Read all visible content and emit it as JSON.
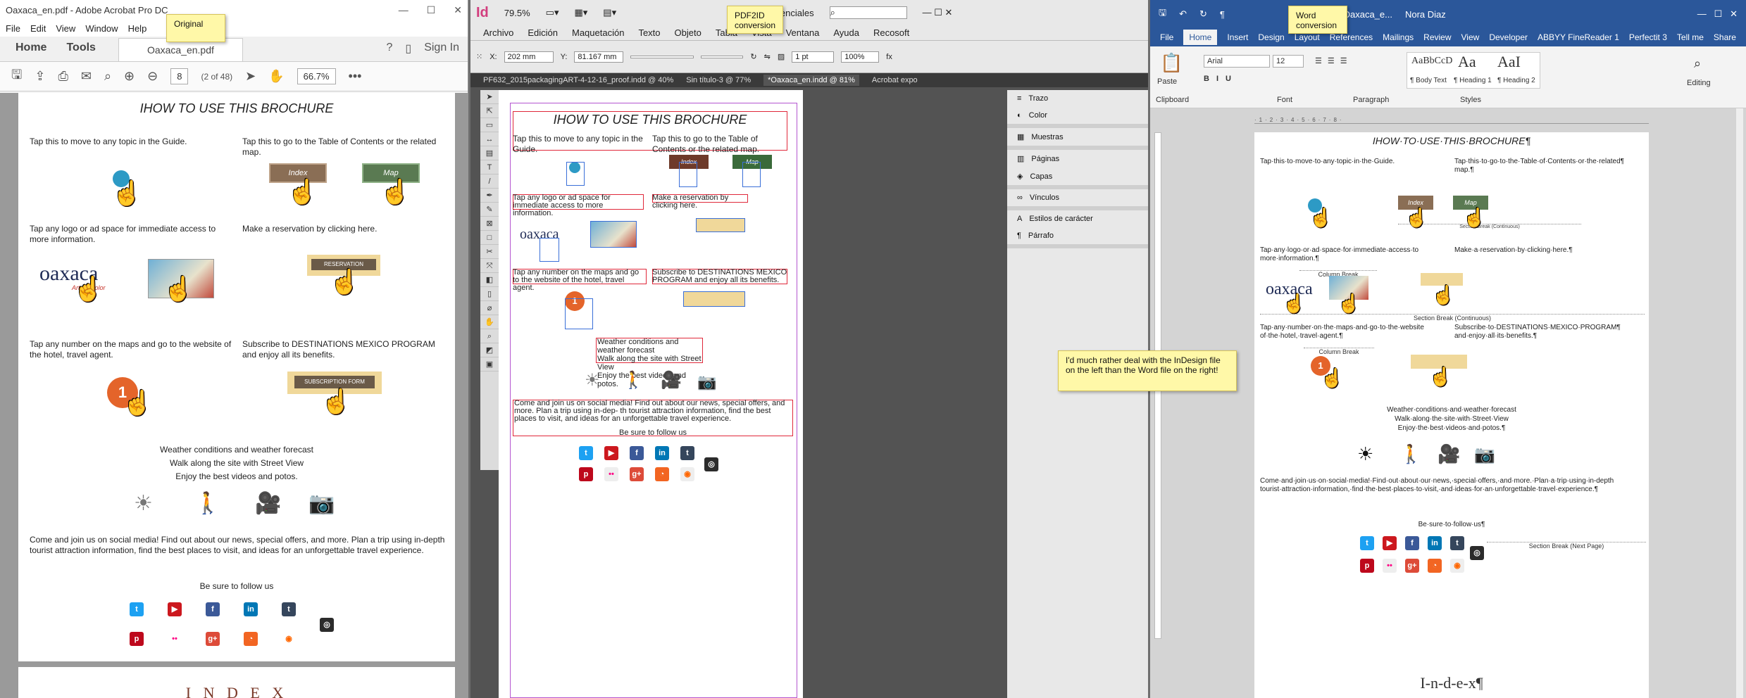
{
  "acrobat": {
    "title": "Oaxaca_en.pdf - Adobe Acrobat Pro DC",
    "menu": [
      "File",
      "Edit",
      "View",
      "Window",
      "Help"
    ],
    "tabs": {
      "home": "Home",
      "tools": "Tools",
      "doc": "Oaxaca_en.pdf",
      "signin": "Sign In"
    },
    "page_num": "8",
    "page_count": "(2 of 48)",
    "zoom": "66.7%",
    "note": "Original"
  },
  "brochure": {
    "title": "IHOW TO USE THIS BROCHURE",
    "t1": "Tap this to move to any topic in the Guide.",
    "t2": "Tap this to go to the Table of Contents or the related map.",
    "index_btn": "Index",
    "map_btn": "Map",
    "t3": "Tap any logo or ad space for immediate access to more information.",
    "t4": "Make a reservation by clicking here.",
    "reservation": "RESERVATION",
    "logo": "oaxaca",
    "logo_sub": "Arte y Color",
    "t5": "Tap any number on the maps and go to the website of the hotel, travel agent.",
    "t6": "Subscribe to DESTINATIONS MEXICO PROGRAM and enjoy all its benefits.",
    "subscription": "SUBSCRIPTION FORM",
    "pin_num": "1",
    "weather1": "Weather conditions and weather forecast",
    "weather2": "Walk along the site with Street View",
    "weather3": "Enjoy the best videos and potos.",
    "social_text": "Come and join us on social media! Find out about our news, special offers, and more. Plan a trip using in-depth tourist attraction information, find the best places to visit, and ideas for an unforgettable travel experience.",
    "social_text_id": "Come and join us on social media! Find out about our news, special offers, and more. Plan a trip using in-dep- th  tourist attraction information, find the best places to visit, and ideas for an unforgettable travel experience.",
    "follow": "Be sure to follow us",
    "index_heading": "I N D E X",
    "index_heading_word": "I-n-d-e-x¶"
  },
  "indesign": {
    "logo": "Id",
    "zoom": "79.5%",
    "workspace": "Aspectos esenciales",
    "menu": [
      "Archivo",
      "Edición",
      "Maquetación",
      "Texto",
      "Objeto",
      "Tabla",
      "Vista",
      "Ventana",
      "Ayuda",
      "Recosoft"
    ],
    "x": "202 mm",
    "y": "81.167 mm",
    "stroke": "1 pt",
    "zoom2": "100%",
    "doc_tabs": [
      "PF632_2015packagingART-4-12-16_proof.indd @ 40%",
      "Sin título-3 @ 77%",
      "*Oaxaca_en.indd @ 81%",
      "Acrobat expo"
    ],
    "note": "PDF2ID conversion",
    "panels": [
      "Trazo",
      "Color",
      "Muestras",
      "Páginas",
      "Capas",
      "Vínculos",
      "Estilos de carácter",
      "Párrafo"
    ]
  },
  "word": {
    "doc_title": "Oaxaca_e...",
    "user": "Nora Diaz",
    "tabs": [
      "File",
      "Home",
      "Insert",
      "Design",
      "Layout",
      "References",
      "Mailings",
      "Review",
      "View",
      "Developer",
      "ABBYY FineReader 1",
      "Perfectit 3"
    ],
    "tell_me": "Tell me",
    "share": "Share",
    "font": "Arial",
    "size": "12",
    "groups": [
      "Clipboard",
      "Font",
      "Paragraph",
      "Styles",
      "Editing"
    ],
    "styles": [
      "¶ Body Text",
      "¶ Heading 1",
      "¶ Heading 2"
    ],
    "paste": "Paste",
    "note": "Word conversion",
    "title": "IHOW·TO·USE·THIS·BROCHURE¶",
    "w1": "Tap·this·to·move·to·any·topic·in·the·Guide.",
    "w2": "Tap·this·to·go·to·the·Table·of·Contents·or·the·related¶ map.¶",
    "w3": "Tap·any·logo·or·ad·space·for·immediate·access·to more·information.¶",
    "w4": "Make·a·reservation·by·clicking·here.¶",
    "w5": "Tap·any·number·on·the·maps·and·go·to·the·website of·the·hotel,·travel·agent.¶",
    "w6": "Subscribe·to·DESTINATIONS·MEXICO·PROGRAM¶ and·enjoy·all·its·benefits.¶",
    "wv1": "Weather·conditions·and·weather·forecast",
    "wv2": "Walk·along·the·site·with·Street·View",
    "wv3": "Enjoy·the·best·videos·and·potos.¶",
    "wsocial": "Come·and·join·us·on·social·media!·Find·out·about·our·news,·special·offers,·and·more.·Plan·a·trip·using·in-depth tourist·attraction·information,·find·the·best·places·to·visit,·and·ideas·for·an·unforgettable·travel·experience.¶",
    "wfollow": "Be·sure·to·follow·us¶",
    "sb_continuous_small": "Section Break (Continuous)",
    "col_break": "Column Break",
    "sb_continuous": "Section Break (Continuous)",
    "sb_next": "Section Break (Next Page)"
  },
  "comment": "I'd much rather deal with the InDesign file on the left than the Word file on the right!",
  "colors": {
    "acrobat_bg": "#9a9a9a",
    "indesign_bg": "#535353",
    "word_blue": "#2b579a",
    "note_yellow": "#fff8a8",
    "frame_red": "#e0283a"
  }
}
